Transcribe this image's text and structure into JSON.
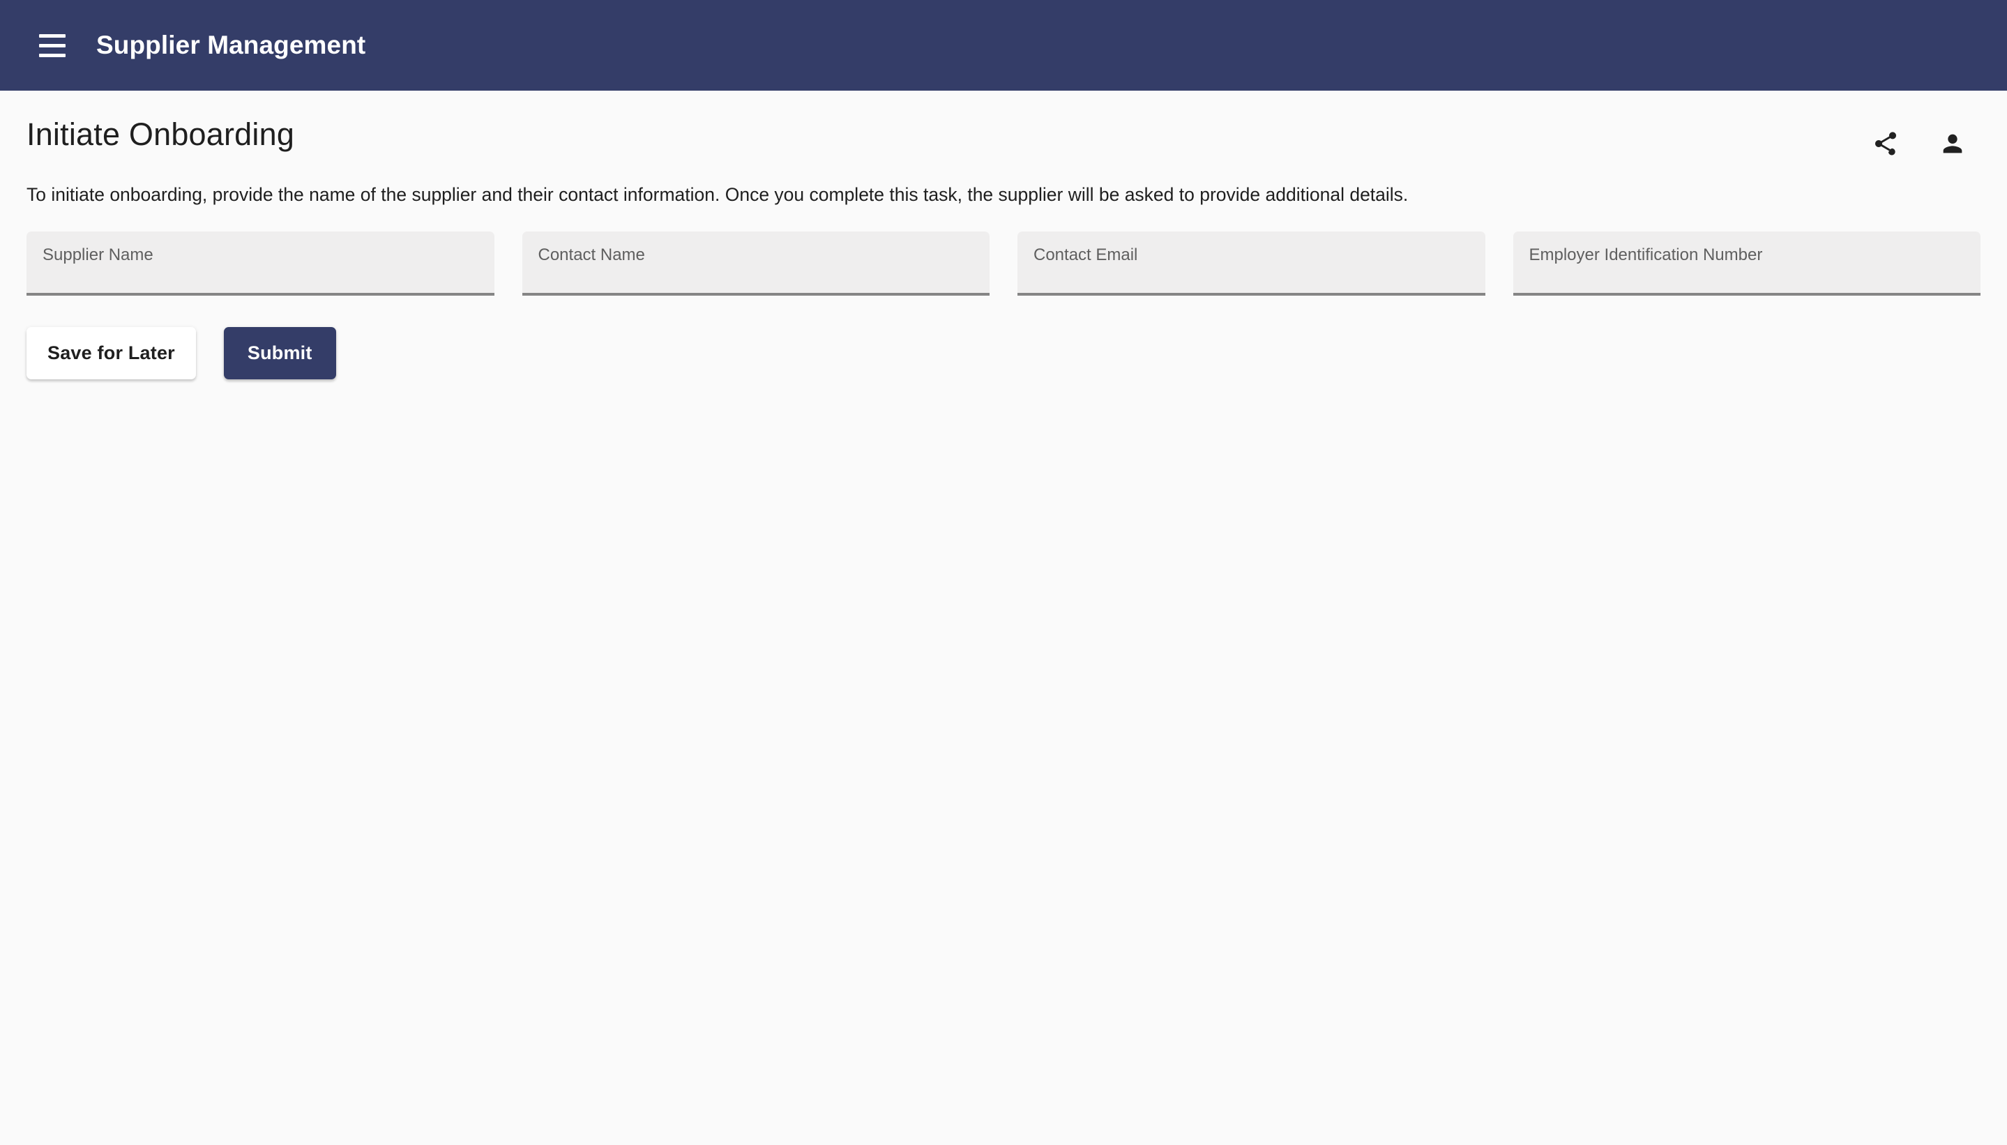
{
  "appbar": {
    "menu_icon": "hamburger-menu-icon",
    "title": "Supplier Management",
    "background_color": "#343d68"
  },
  "page": {
    "title": "Initiate Onboarding",
    "description": "To initiate onboarding, provide the name of the supplier and their contact information. Once you complete this task, the supplier will be asked to provide additional details.",
    "background_color": "#fafafa",
    "actions": [
      {
        "icon": "share-icon",
        "name": "share-button"
      },
      {
        "icon": "person-icon",
        "name": "account-button"
      }
    ]
  },
  "form": {
    "fields": [
      {
        "label": "Supplier Name",
        "value": "",
        "placeholder": ""
      },
      {
        "label": "Contact Name",
        "value": "",
        "placeholder": ""
      },
      {
        "label": "Contact Email",
        "value": "",
        "placeholder": ""
      },
      {
        "label": "Employer Identification Number",
        "value": "",
        "placeholder": ""
      }
    ],
    "buttons": {
      "save_label": "Save for Later",
      "submit_label": "Submit",
      "submit_color": "#343d68"
    }
  }
}
